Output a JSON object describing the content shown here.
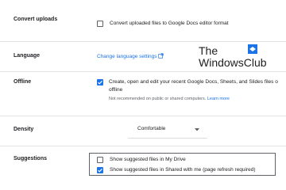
{
  "settings": {
    "convert_uploads": {
      "label": "Convert uploads",
      "checkbox_text": "Convert uploaded files to Google Docs editor format",
      "checked": false
    },
    "language": {
      "label": "Language",
      "link_text": "Change language settings"
    },
    "offline": {
      "label": "Offline",
      "checkbox_text_line1": "Create, open and edit your recent Google Docs, Sheets, and Slides files o",
      "checkbox_text_line2": "offline",
      "note": "Not recommended on public or shared computers.",
      "note_link": "Learn more",
      "checked": true
    },
    "density": {
      "label": "Density",
      "selected": "Comfortable"
    },
    "suggestions": {
      "label": "Suggestions",
      "option1": {
        "text": "Show suggested files in My Drive",
        "checked": false
      },
      "option2": {
        "text": "Show suggested files in Shared with me (page refresh required)",
        "checked": true
      }
    }
  },
  "watermark": {
    "line1": "The",
    "line2": "WindowsClub"
  },
  "colors": {
    "accent": "#1a73e8",
    "text": "#202124",
    "subtext": "#5f6368",
    "divider": "#e3e3e3"
  }
}
